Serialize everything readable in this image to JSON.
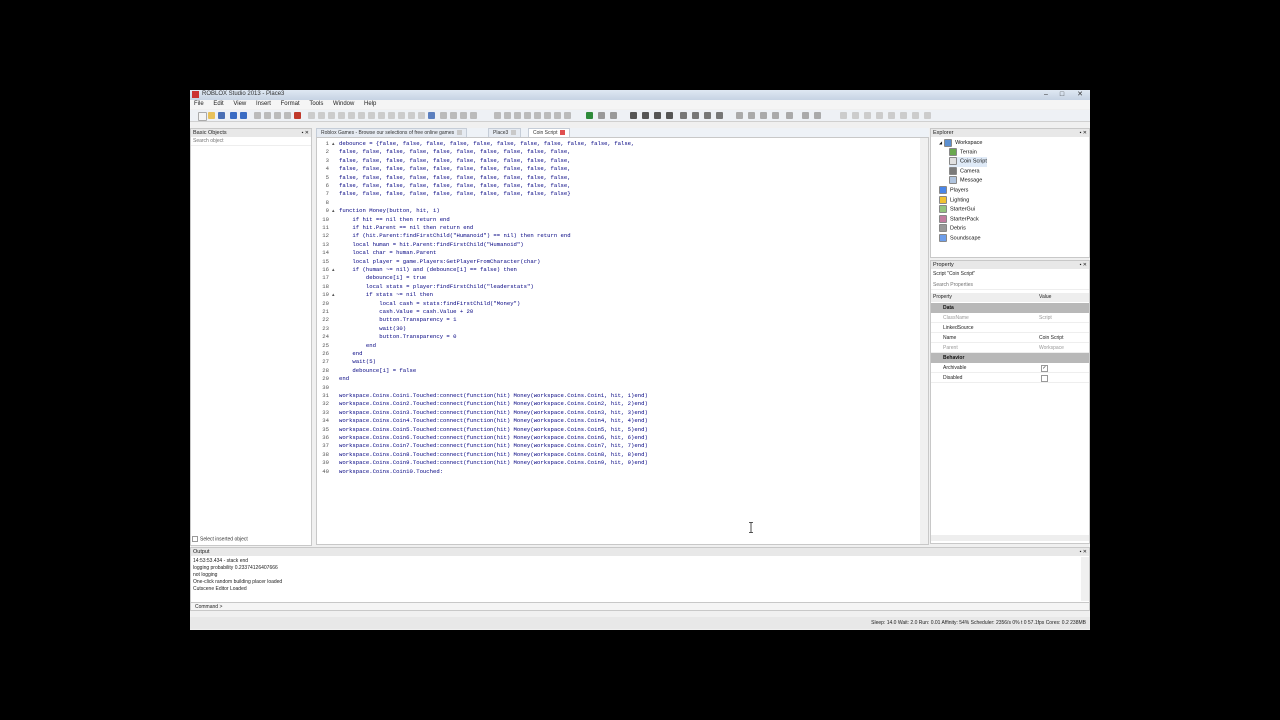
{
  "window": {
    "title": "ROBLOX Studio 2013 - Place3",
    "controls": {
      "minimize": "–",
      "maximize": "□",
      "close": "✕"
    }
  },
  "menu": [
    "File",
    "Edit",
    "View",
    "Insert",
    "Format",
    "Tools",
    "Window",
    "Help"
  ],
  "basic_objects": {
    "title": "Basic Objects",
    "search_placeholder": "Search object",
    "footer_label": "Select inserted object"
  },
  "tabs": [
    {
      "label": "Roblox Games - Browse our selections of free online games",
      "active": false
    },
    {
      "label": "Place3",
      "active": false
    },
    {
      "label": "Coin Script",
      "active": true
    }
  ],
  "editor": {
    "lines": [
      {
        "n": "1",
        "fold": true,
        "text": "debounce = {false, false, false, false, false, false, false, false, false, false, false,"
      },
      {
        "n": "2",
        "text": "false, false, false, false, false, false, false, false, false, false,"
      },
      {
        "n": "3",
        "text": "false, false, false, false, false, false, false, false, false, false,"
      },
      {
        "n": "4",
        "text": "false, false, false, false, false, false, false, false, false, false,"
      },
      {
        "n": "5",
        "text": "false, false, false, false, false, false, false, false, false, false,"
      },
      {
        "n": "6",
        "text": "false, false, false, false, false, false, false, false, false, false,"
      },
      {
        "n": "7",
        "text": "false, false, false, false, false, false, false, false, false, false}"
      },
      {
        "n": "8",
        "text": ""
      },
      {
        "n": "9",
        "fold": true,
        "text": "function Money(button, hit, i)"
      },
      {
        "n": "10",
        "text": "    if hit == nil then return end"
      },
      {
        "n": "11",
        "text": "    if hit.Parent == nil then return end"
      },
      {
        "n": "12",
        "text": "    if (hit.Parent:findFirstChild(\"Humanoid\") == nil) then return end"
      },
      {
        "n": "13",
        "text": "    local human = hit.Parent:findFirstChild(\"Humanoid\")"
      },
      {
        "n": "14",
        "text": "    local char = human.Parent"
      },
      {
        "n": "15",
        "text": "    local player = game.Players:GetPlayerFromCharacter(char)"
      },
      {
        "n": "16",
        "fold": true,
        "text": "    if (human ~= nil) and (debounce[i] == false) then"
      },
      {
        "n": "17",
        "text": "        debounce[i] = true"
      },
      {
        "n": "18",
        "text": "        local stats = player:findFirstChild(\"leaderstats\")"
      },
      {
        "n": "19",
        "fold": true,
        "text": "        if stats ~= nil then"
      },
      {
        "n": "20",
        "text": "            local cash = stats:findFirstChild(\"Money\")"
      },
      {
        "n": "21",
        "text": "            cash.Value = cash.Value + 20"
      },
      {
        "n": "22",
        "text": "            button.Transparency = 1"
      },
      {
        "n": "23",
        "text": "            wait(30)"
      },
      {
        "n": "24",
        "text": "            button.Transparency = 0"
      },
      {
        "n": "25",
        "text": "        end"
      },
      {
        "n": "26",
        "text": "    end"
      },
      {
        "n": "27",
        "text": "    wait(5)"
      },
      {
        "n": "28",
        "text": "    debounce[i] = false"
      },
      {
        "n": "29",
        "text": "end"
      },
      {
        "n": "30",
        "text": ""
      },
      {
        "n": "31",
        "text": "workspace.Coins.Coin1.Touched:connect(function(hit) Money(workspace.Coins.Coin1, hit, 1)end)"
      },
      {
        "n": "32",
        "text": "workspace.Coins.Coin2.Touched:connect(function(hit) Money(workspace.Coins.Coin2, hit, 2)end)"
      },
      {
        "n": "33",
        "text": "workspace.Coins.Coin3.Touched:connect(function(hit) Money(workspace.Coins.Coin3, hit, 3)end)"
      },
      {
        "n": "34",
        "text": "workspace.Coins.Coin4.Touched:connect(function(hit) Money(workspace.Coins.Coin4, hit, 4)end)"
      },
      {
        "n": "35",
        "text": "workspace.Coins.Coin5.Touched:connect(function(hit) Money(workspace.Coins.Coin5, hit, 5)end)"
      },
      {
        "n": "36",
        "text": "workspace.Coins.Coin6.Touched:connect(function(hit) Money(workspace.Coins.Coin6, hit, 6)end)"
      },
      {
        "n": "37",
        "text": "workspace.Coins.Coin7.Touched:connect(function(hit) Money(workspace.Coins.Coin7, hit, 7)end)"
      },
      {
        "n": "38",
        "text": "workspace.Coins.Coin8.Touched:connect(function(hit) Money(workspace.Coins.Coin8, hit, 8)end)"
      },
      {
        "n": "39",
        "text": "workspace.Coins.Coin9.Touched:connect(function(hit) Money(workspace.Coins.Coin9, hit, 9)end)"
      },
      {
        "n": "40",
        "text": "workspace.Coins.Coin10.Touched:"
      }
    ]
  },
  "explorer": {
    "title": "Explorer",
    "items": [
      {
        "label": "Workspace",
        "icon": "workspace-icon",
        "color": "#5b8fd0",
        "level": 0,
        "expanded": true
      },
      {
        "label": "Terrain",
        "icon": "terrain-icon",
        "color": "#6aa84f",
        "level": 1
      },
      {
        "label": "Coin Script",
        "icon": "script-icon",
        "color": "#e0e0e0",
        "level": 1,
        "selected": true
      },
      {
        "label": "Camera",
        "icon": "camera-icon",
        "color": "#7a7a7a",
        "level": 1
      },
      {
        "label": "Message",
        "icon": "message-icon",
        "color": "#b0c4de",
        "level": 1
      },
      {
        "label": "Players",
        "icon": "players-icon",
        "color": "#4a86e8",
        "level": 0
      },
      {
        "label": "Lighting",
        "icon": "lighting-icon",
        "color": "#f1c232",
        "level": 0
      },
      {
        "label": "StarterGui",
        "icon": "startergui-icon",
        "color": "#93c47d",
        "level": 0
      },
      {
        "label": "StarterPack",
        "icon": "starterpack-icon",
        "color": "#c27ba0",
        "level": 0
      },
      {
        "label": "Debris",
        "icon": "debris-icon",
        "color": "#999999",
        "level": 0
      },
      {
        "label": "Soundscape",
        "icon": "soundscape-icon",
        "color": "#6d9eeb",
        "level": 0
      }
    ]
  },
  "properties": {
    "title": "Property",
    "subtitle": "Script \"Coin Script\"",
    "search_placeholder": "Search Properties",
    "col_property": "Property",
    "col_value": "Value",
    "rows": [
      {
        "type": "category",
        "name": "Data"
      },
      {
        "type": "prop",
        "name": "ClassName",
        "value": "Script",
        "dim": true
      },
      {
        "type": "prop",
        "name": "LinkedSource",
        "value": ""
      },
      {
        "type": "prop",
        "name": "Name",
        "value": "Coin Script"
      },
      {
        "type": "prop",
        "name": "Parent",
        "value": "Workspace",
        "dim": true
      },
      {
        "type": "category",
        "name": "Behavior"
      },
      {
        "type": "check",
        "name": "Archivable",
        "checked": true
      },
      {
        "type": "check",
        "name": "Disabled",
        "checked": false
      }
    ]
  },
  "output": {
    "title": "Output",
    "lines": [
      "14:53:53.434 - stack end",
      "logging probability 0.23374126407666",
      "not logging",
      "One-click random building placer loaded",
      "Cutscene Editor Loaded"
    ]
  },
  "command": {
    "label": "Command >",
    "value": ""
  },
  "status": {
    "text": "Sleep: 14.0  Wait: 2.0  Run: 0.01  Affinity: 54%  Scheduler: 2356/s 0%     t 0     57.1fps     Cores: 0.2     238MB"
  }
}
